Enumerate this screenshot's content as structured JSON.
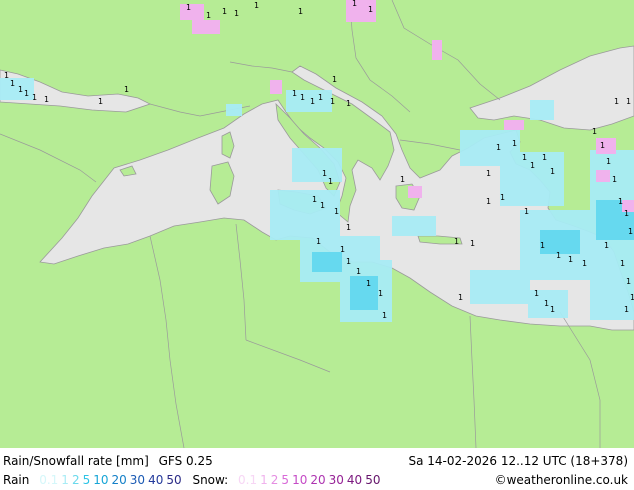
{
  "title": "Rain/Snowfall rate [mm]",
  "model": "GFS 0.25",
  "valid_time": "Sa 14-02-2026 12..12 UTC (18+378)",
  "credit": "©weatheronline.co.uk",
  "legend": {
    "rain_label": "Rain",
    "rain_levels": [
      {
        "text": "0.1",
        "color": "#d4f7fa"
      },
      {
        "text": "1",
        "color": "#a8ecf5"
      },
      {
        "text": "2",
        "color": "#6ad9ec"
      },
      {
        "text": "5",
        "color": "#2ec4e6"
      },
      {
        "text": "10",
        "color": "#17a5d6"
      },
      {
        "text": "20",
        "color": "#1480c8"
      },
      {
        "text": "30",
        "color": "#1a5ab4"
      },
      {
        "text": "40",
        "color": "#233a9c"
      },
      {
        "text": "50",
        "color": "#2a2a86"
      }
    ],
    "snow_label": "Snow:",
    "snow_levels": [
      {
        "text": "0.1",
        "color": "#f7d6f5"
      },
      {
        "text": "1",
        "color": "#f0b2ed"
      },
      {
        "text": "2",
        "color": "#e58ee2"
      },
      {
        "text": "5",
        "color": "#d86ad8"
      },
      {
        "text": "10",
        "color": "#c54ac6"
      },
      {
        "text": "20",
        "color": "#ad33b0"
      },
      {
        "text": "30",
        "color": "#962296"
      },
      {
        "text": "40",
        "color": "#7c1a80"
      },
      {
        "text": "50",
        "color": "#64146a"
      }
    ]
  },
  "colors": {
    "land": "#b6ec95",
    "sea": "#e6e6e6",
    "border": "#9a9a9a",
    "rain_light": "#a8ecf5",
    "rain_mid": "#66d9ef",
    "snow": "#f0b2ed",
    "marker": "#000000"
  },
  "marker_glyph": "1"
}
